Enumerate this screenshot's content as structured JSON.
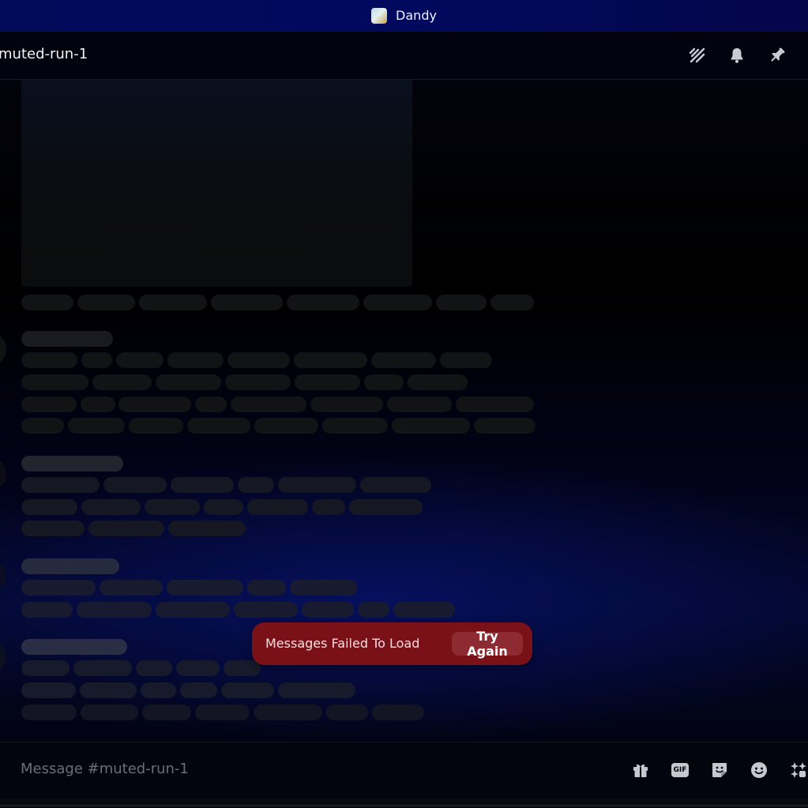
{
  "window": {
    "title": "Dandy"
  },
  "header": {
    "channel_name": "muted-run-1",
    "icons": [
      "threads-icon",
      "bell-icon",
      "pin-icon"
    ]
  },
  "error": {
    "message": "Messages Failed To Load",
    "retry_label": "Try Again"
  },
  "composer": {
    "placeholder": "Message #muted-run-1",
    "icons": [
      "gift-icon",
      "gif-icon",
      "sticker-icon",
      "emoji-icon",
      "apps-icon"
    ],
    "gif_label": "GIF"
  },
  "colors": {
    "error_bg": "#7a1119",
    "titlebar_bg": "#01095f",
    "skeleton": "#121315"
  }
}
